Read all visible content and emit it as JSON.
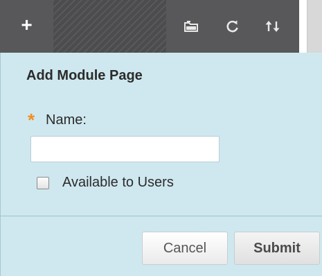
{
  "toolbar": {
    "add_glyph": "+",
    "icons": [
      "plus-icon",
      "folder-icon",
      "refresh-icon",
      "reorder-icon"
    ]
  },
  "form": {
    "title": "Add Module Page",
    "required_marker": "*",
    "name_label": "Name:",
    "name_value": "",
    "available_label": "Available to Users",
    "available_checked": false,
    "cancel_label": "Cancel",
    "submit_label": "Submit"
  },
  "colors": {
    "toolbar_bg": "#58585a",
    "panel_bg": "#cfe8ef",
    "required_star": "#f0901e",
    "text": "#2b2b2b"
  }
}
